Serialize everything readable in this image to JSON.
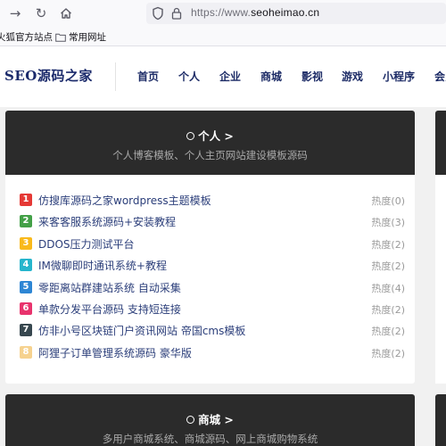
{
  "browser": {
    "url_main": "https://www.",
    "url_domain": "seoheimao.cn",
    "bookmarks": [
      {
        "label": "火狐官方站点"
      },
      {
        "label": "常用网址"
      }
    ]
  },
  "site": {
    "logo": "SEO源码之家",
    "menu": [
      "首页",
      "个人",
      "企业",
      "商城",
      "影视",
      "游戏",
      "小程序",
      "会员"
    ]
  },
  "sections": [
    {
      "title": "个人 >",
      "subtitle": "个人博客模板、个人主页网站建设模板源码",
      "posts": [
        {
          "rank": "1",
          "title": "仿搜库源码之家wordpress主题模板",
          "heat": "热度(0)",
          "color": "#e53935"
        },
        {
          "rank": "2",
          "title": "来客客服系统源码+安装教程",
          "heat": "热度(3)",
          "color": "#43a047"
        },
        {
          "rank": "3",
          "title": "DDOS压力测试平台",
          "heat": "热度(2)",
          "color": "#f9b91b"
        },
        {
          "rank": "4",
          "title": "IM微聊即时通讯系统+教程",
          "heat": "热度(2)",
          "color": "#26b5cc"
        },
        {
          "rank": "5",
          "title": "零距离站群建站系统 自动采集",
          "heat": "热度(4)",
          "color": "#2d86d4"
        },
        {
          "rank": "6",
          "title": "单款分发平台源码 支持短连接",
          "heat": "热度(2)",
          "color": "#e8336d"
        },
        {
          "rank": "7",
          "title": "仿非小号区块链门户资讯网站 帝国cms模板",
          "heat": "热度(2)",
          "color": "#37474f"
        },
        {
          "rank": "8",
          "title": "阿狸子订单管理系统源码 豪华版",
          "heat": "热度(2)",
          "color": "#f6d28f"
        }
      ]
    },
    {
      "title": "商城 >",
      "subtitle": "多用户商城系统、商城源码、网上商城购物系统"
    }
  ]
}
